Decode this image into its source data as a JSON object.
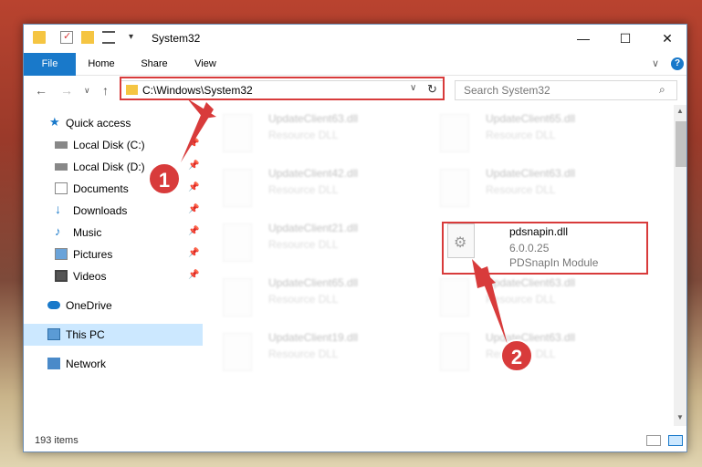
{
  "window": {
    "title": "System32"
  },
  "ribbon": {
    "tabs": [
      "File",
      "Home",
      "Share",
      "View"
    ]
  },
  "nav": {
    "address": "C:\\Windows\\System32",
    "search_placeholder": "Search System32"
  },
  "sidebar": {
    "items": [
      {
        "label": "Quick access",
        "icon": "star-icon",
        "pinned": false
      },
      {
        "label": "Local Disk (C:)",
        "icon": "drive-icon",
        "pinned": true
      },
      {
        "label": "Local Disk (D:)",
        "icon": "drive-icon",
        "pinned": true
      },
      {
        "label": "Documents",
        "icon": "documents-icon",
        "pinned": true
      },
      {
        "label": "Downloads",
        "icon": "download-icon",
        "pinned": true
      },
      {
        "label": "Music",
        "icon": "music-icon",
        "pinned": true
      },
      {
        "label": "Pictures",
        "icon": "pictures-icon",
        "pinned": true
      },
      {
        "label": "Videos",
        "icon": "videos-icon",
        "pinned": true
      },
      {
        "label": "OneDrive",
        "icon": "cloud-icon",
        "pinned": false
      },
      {
        "label": "This PC",
        "icon": "computer-icon",
        "pinned": false,
        "selected": true
      },
      {
        "label": "Network",
        "icon": "network-icon",
        "pinned": false
      }
    ]
  },
  "files": [
    {
      "name": "UpdateClient63.dll",
      "type": "Resource DLL"
    },
    {
      "name": "UpdateClient65.dll",
      "type": "Resource DLL"
    },
    {
      "name": "UpdateClient42.dll",
      "type": "Resource DLL"
    },
    {
      "name": "UpdateClient63.dll",
      "type": "Resource DLL"
    },
    {
      "name": "UpdateClient21.dll",
      "type": "Resource DLL"
    },
    {
      "name": "pdsnapin.dll",
      "version": "6.0.0.25",
      "type": "PDSnapIn Module",
      "highlighted": true
    },
    {
      "name": "UpdateClient65.dll",
      "type": "Resource DLL"
    },
    {
      "name": "UpdateClient63.dll",
      "type": "Resource DLL"
    },
    {
      "name": "UpdateClient19.dll",
      "type": "Resource DLL"
    },
    {
      "name": "UpdateClient63.dll",
      "type": "Resource DLL"
    }
  ],
  "status": {
    "items": "193 items"
  },
  "annotations": {
    "step1": "1",
    "step2": "2"
  },
  "colors": {
    "accent": "#1979ca",
    "highlight": "#d83b3b",
    "selection": "#cce8ff"
  }
}
